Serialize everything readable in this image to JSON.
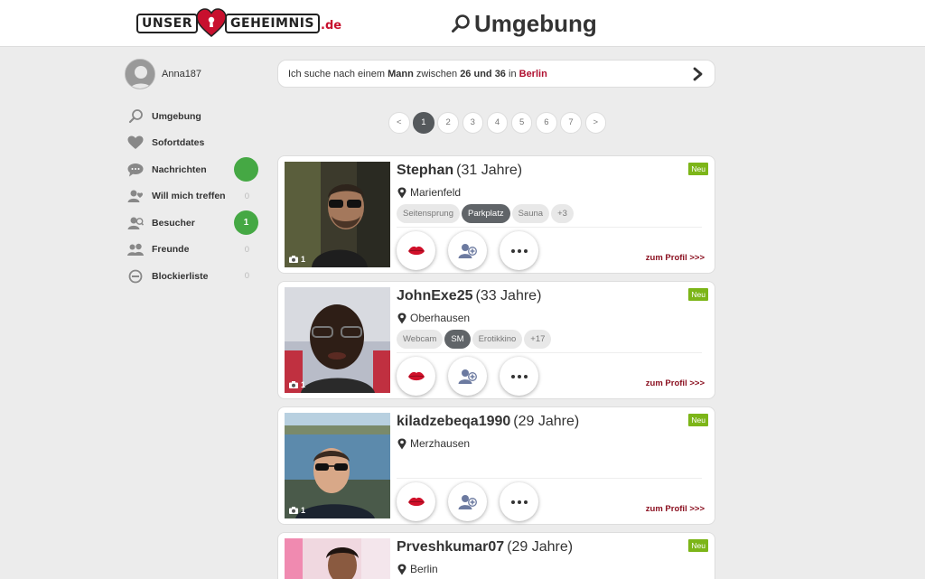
{
  "header": {
    "logo_left": "UNSER",
    "logo_right": "GEHEIMNIS",
    "logo_tld": ".de",
    "title": "Umgebung"
  },
  "sidebar": {
    "username": "Anna187",
    "items": [
      {
        "label": "Umgebung",
        "icon": "search-icon"
      },
      {
        "label": "Sofortdates",
        "icon": "heart-icon"
      },
      {
        "label": "Nachrichten",
        "icon": "chat-icon",
        "badge": ""
      },
      {
        "label": "Will mich treffen",
        "icon": "user-heart-icon",
        "count": "0"
      },
      {
        "label": "Besucher",
        "icon": "visitor-icon",
        "badge": "1"
      },
      {
        "label": "Freunde",
        "icon": "friends-icon",
        "count": "0"
      },
      {
        "label": "Blockierliste",
        "icon": "block-icon",
        "count": "0"
      }
    ]
  },
  "search": {
    "prefix": "Ich suche nach einem",
    "gender": "Mann",
    "between": "zwischen",
    "age_range": "26 und 36",
    "in": "in",
    "city": "Berlin"
  },
  "pagination": [
    "<",
    "1",
    "2",
    "3",
    "4",
    "5",
    "6",
    "7",
    ">"
  ],
  "pagination_active": "1",
  "cards": [
    {
      "name": "Stephan",
      "age": "(31 Jahre)",
      "location": "Marienfeld",
      "photos": "1",
      "badge": "Neu",
      "tags": [
        "Seitensprung",
        "Parkplatz",
        "Sauna",
        "+3"
      ],
      "link": "zum Profil >>>"
    },
    {
      "name": "JohnExe25",
      "age": "(33 Jahre)",
      "location": "Oberhausen",
      "photos": "1",
      "badge": "Neu",
      "tags": [
        "Webcam",
        "SM",
        "Erotikkino",
        "+17"
      ],
      "link": "zum Profil >>>"
    },
    {
      "name": "kiladzebeqa1990",
      "age": "(29 Jahre)",
      "location": "Merzhausen",
      "photos": "1",
      "badge": "Neu",
      "tags": [],
      "link": "zum Profil >>>"
    },
    {
      "name": "Prveshkumar07",
      "age": "(29 Jahre)",
      "location": "Berlin",
      "photos": "",
      "badge": "Neu",
      "tags": [],
      "link": ""
    }
  ],
  "colors": {
    "accent": "#b01030",
    "badge_green": "#45a844",
    "new_green": "#7cb518"
  }
}
